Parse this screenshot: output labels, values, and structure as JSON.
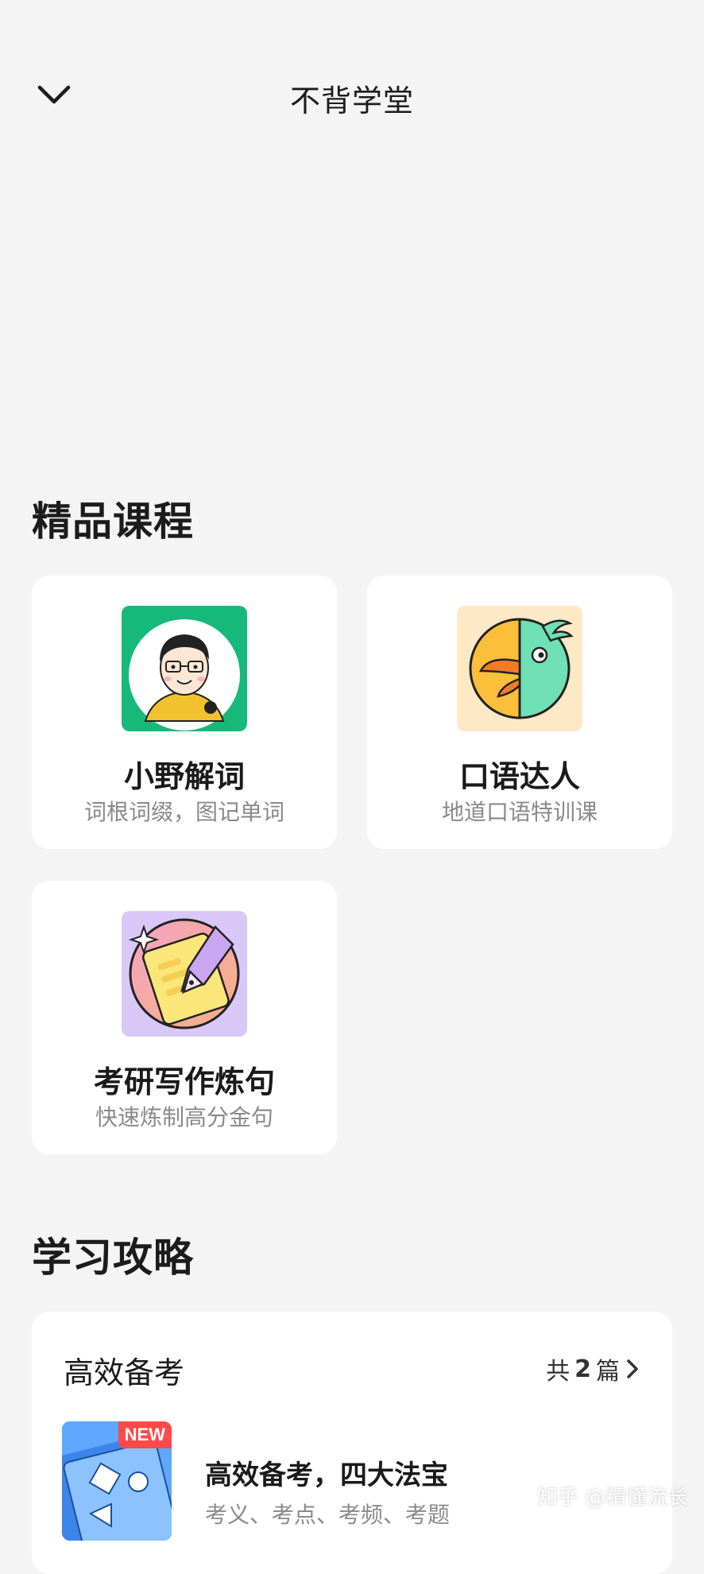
{
  "header": {
    "title": "不背学堂",
    "back_icon": "chevron-down-icon"
  },
  "sections": {
    "courses_title": "精品课程",
    "strategy_title": "学习攻略"
  },
  "courses": [
    {
      "name": "小野解词",
      "desc": "词根词缀，图记单词",
      "icon": "avatar-xiaoye-icon",
      "accent": "#17b97a"
    },
    {
      "name": "口语达人",
      "desc": "地道口语特训课",
      "icon": "parrot-icon",
      "accent": "#fde9c5"
    },
    {
      "name": "考研写作炼句",
      "desc": "快速炼制高分金句",
      "icon": "fountain-pen-icon",
      "accent": "#d8c7f7"
    }
  ],
  "strategy": {
    "category": "高效备考",
    "count_prefix": "共",
    "count": "2",
    "count_suffix": "篇",
    "article": {
      "badge": "NEW",
      "title": "高效备考，四大法宝",
      "desc": "考义、考点、考频、考题"
    }
  },
  "watermark": "知乎 @精懂流长"
}
